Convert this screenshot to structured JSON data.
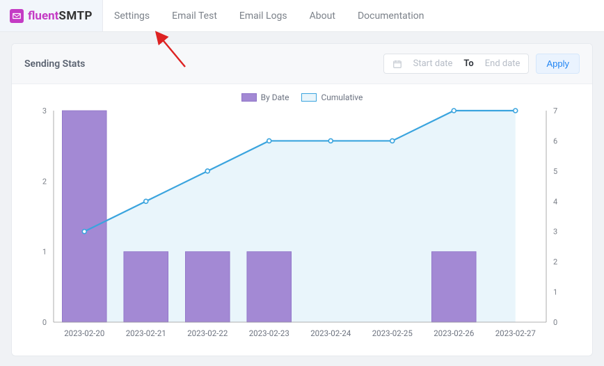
{
  "brand": {
    "name_part1": "fluent",
    "name_part2": "SMTP"
  },
  "nav": {
    "items": [
      {
        "label": "Settings"
      },
      {
        "label": "Email Test"
      },
      {
        "label": "Email Logs"
      },
      {
        "label": "About"
      },
      {
        "label": "Documentation"
      }
    ]
  },
  "panel": {
    "title": "Sending Stats"
  },
  "date_filter": {
    "start_placeholder": "Start date",
    "to_label": "To",
    "end_placeholder": "End date",
    "apply_label": "Apply"
  },
  "legend": {
    "bar": "By Date",
    "line": "Cumulative"
  },
  "chart_data": {
    "type": "bar+line",
    "categories": [
      "2023-02-20",
      "2023-02-21",
      "2023-02-22",
      "2023-02-23",
      "2023-02-24",
      "2023-02-25",
      "2023-02-26",
      "2023-02-27"
    ],
    "series": [
      {
        "name": "By Date",
        "type": "bar",
        "axis": "left",
        "values": [
          3,
          1,
          1,
          1,
          0,
          0,
          1,
          0
        ]
      },
      {
        "name": "Cumulative",
        "type": "line",
        "axis": "right",
        "values": [
          3,
          4,
          5,
          6,
          6,
          6,
          7,
          7
        ]
      }
    ],
    "y_left": {
      "min": 0,
      "max": 3,
      "step": 1
    },
    "y_right": {
      "min": 0,
      "max": 7,
      "step": 1
    },
    "colors": {
      "bar": "#a389d4",
      "line": "#3aa4de",
      "area": "#e9f5fb"
    }
  }
}
